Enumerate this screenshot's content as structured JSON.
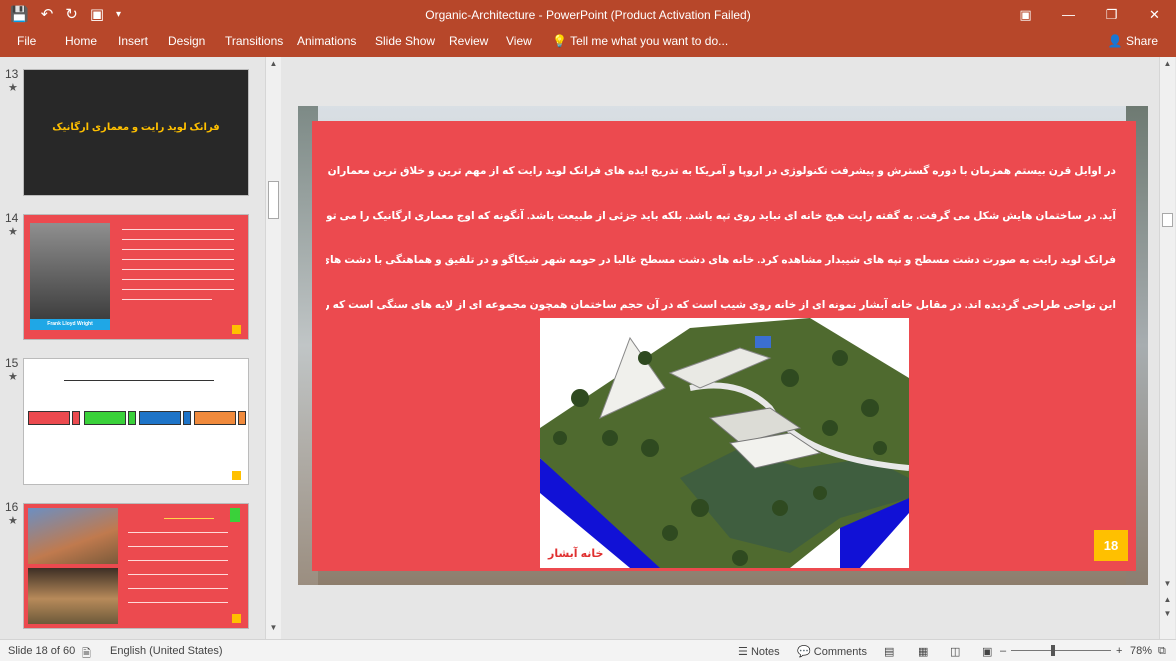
{
  "window": {
    "title": "Organic-Architecture - PowerPoint (Product Activation Failed)",
    "controls": [
      "▣",
      "—",
      "❐",
      "✕"
    ]
  },
  "quick_access": [
    "save-icon",
    "undo-icon",
    "redo-icon",
    "present-icon",
    "customize-icon"
  ],
  "ribbon": {
    "tabs": [
      "File",
      "Home",
      "Insert",
      "Design",
      "Transitions",
      "Animations",
      "Slide Show",
      "Review",
      "View"
    ],
    "tell_me": "Tell me what you want to do...",
    "share": "Share"
  },
  "thumbnails": [
    {
      "number": "13",
      "star": "★",
      "title": "فرانک لوید رایت و معماری ارگانیک"
    },
    {
      "number": "14",
      "star": "★",
      "caption": "Frank Lloyd Wright"
    },
    {
      "number": "15",
      "star": "★"
    },
    {
      "number": "16",
      "star": "★"
    }
  ],
  "slide": {
    "paragraph_lines": [
      "در اوایل قرن بیستم همزمان با دوره گسترش و پیشرفت تکنولوژی در اروپا و آمریکا به تدریج ایده های فرانک لوید رایت که از مهم ترین و خلاق ترین معماران قرن بیستم به شمار می",
      "آید. در ساختمان هایش شکل می گرفت. به گفته رایت هیچ خانه ای نباید روی تپه باشد. بلکه باید جزئی از طبیعت باشد. آنگونه که اوج معماری ارگانیک را می توان در خانه های ویلایی",
      "فرانک لوید رایت به صورت دشت مسطح و تپه های شیبدار مشاهده کرد. خانه های دشت مسطح غالبا در حومه شهر شیکاگو و در تلفیق و هماهنگی با دشت های مسطح و سر سبز",
      "این نواحی طراحی گردیده اند. در مقابل خانه آبشار نمونه ای از خانه روی شیب است که در آن حجم ساختمان همچون مجموعه ای از لایه های سنگی است که روی هم قرار دارند."
    ],
    "image_caption": "خانه آبشار",
    "page_number": "18"
  },
  "status": {
    "slide_info": "Slide 18 of 60",
    "language": "English (United States)",
    "notes": "Notes",
    "comments": "Comments",
    "zoom": "78%",
    "minus": "–",
    "plus": "+"
  },
  "colors": {
    "ribbon": "#b7472a",
    "slide_panel": "#ec4a4f",
    "badge": "#ffc000"
  }
}
